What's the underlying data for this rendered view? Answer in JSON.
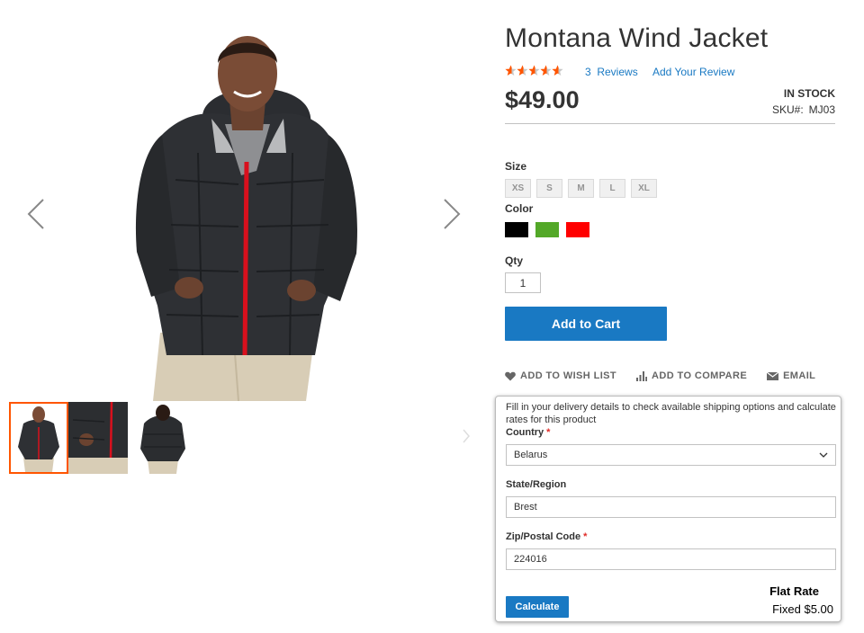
{
  "product": {
    "title": "Montana Wind Jacket",
    "rating_percent": 60,
    "reviews_label": "3  Reviews",
    "add_review_label": "Add Your Review",
    "price": "$49.00",
    "stock_status": "IN STOCK",
    "sku_label": "SKU#:",
    "sku_value": "MJ03"
  },
  "options": {
    "size_label": "Size",
    "sizes": [
      "XS",
      "S",
      "M",
      "L",
      "XL"
    ],
    "color_label": "Color",
    "colors": [
      {
        "name": "Black",
        "hex": "#000000"
      },
      {
        "name": "Green",
        "hex": "#53a828"
      },
      {
        "name": "Red",
        "hex": "#ff0000"
      }
    ],
    "qty_label": "Qty",
    "qty_value": "1"
  },
  "actions": {
    "add_to_cart": "Add to Cart",
    "wishlist": "ADD TO WISH LIST",
    "compare": "ADD TO COMPARE",
    "email": "EMAIL"
  },
  "shipping": {
    "intro": "Fill in your delivery details to check available shipping options and calculate rates for this product",
    "country_label": "Country",
    "country_value": "Belarus",
    "region_label": "State/Region",
    "region_value": "Brest",
    "zip_label": "Zip/Postal Code",
    "zip_value": "224016",
    "calculate_label": "Calculate",
    "rate_name": "Flat Rate",
    "rate_price": "Fixed $5.00"
  },
  "gallery": {
    "thumbnail_count": 3,
    "active_thumbnail": 0
  },
  "colors": {
    "accent": "#1979c3",
    "rating_star": "#ff5501",
    "required": "#e02b27",
    "active_thumb_border": "#ff5501"
  }
}
